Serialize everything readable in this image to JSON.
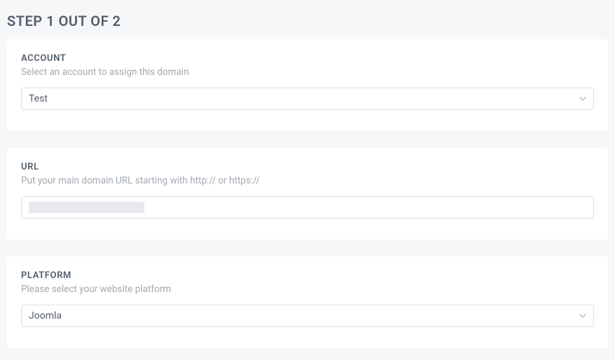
{
  "page": {
    "title": "STEP 1 OUT OF 2"
  },
  "account": {
    "label": "ACCOUNT",
    "hint": "Select an account to assign this domain",
    "value": "Test"
  },
  "url": {
    "label": "URL",
    "hint": "Put your main domain URL starting with http:// or https://",
    "value": ""
  },
  "platform": {
    "label": "PLATFORM",
    "hint": "Please select your website platform",
    "value": "Joomla"
  }
}
